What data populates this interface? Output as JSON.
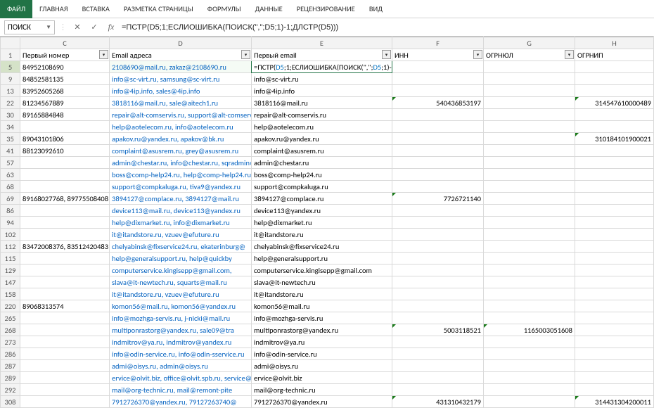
{
  "ribbon": {
    "tabs": [
      "ФАЙЛ",
      "ГЛАВНАЯ",
      "ВСТАВКА",
      "РАЗМЕТКА СТРАНИЦЫ",
      "ФОРМУЛЫ",
      "ДАННЫЕ",
      "РЕЦЕНЗИРОВАНИЕ",
      "ВИД"
    ],
    "active": 0
  },
  "formula_bar": {
    "namebox": "ПОИСК",
    "formula_plain": "=ПСТР(D5;1;ЕСЛИОШИБКА(ПОИСК(\",\";D5;1)-1;ДЛСТР(D5)))",
    "cell_formula": "=ПСТР(D5;1;ЕСЛИОШИБКА(ПОИСК(\",\";D5;1)-1;ДЛСТР(D5)))"
  },
  "columns": [
    "C",
    "D",
    "E",
    "F",
    "G",
    "H"
  ],
  "headers": {
    "C": "Первый номер",
    "D": "Email адреса",
    "E": "Первый email",
    "F": "ИНН",
    "G": "ОГРНЮЛ",
    "H": "ОГРНИП"
  },
  "rows": [
    {
      "n": "5",
      "C": "84952108690",
      "D": "2108690@mail.ru, zakaz@2108690.ru",
      "E": "=ПСТР(D5;1;ЕСЛИОШИБКА(ПОИСК(\",\";D5;1)-1;ДЛСТР(D5)))",
      "F": "",
      "G": "",
      "H": ""
    },
    {
      "n": "9",
      "C": "84852581135",
      "D": "info@sc-virt.ru, samsung@sc-virt.ru",
      "E": "info@sc-virt.ru",
      "F": "",
      "G": "",
      "H": ""
    },
    {
      "n": "13",
      "C": "83952605268",
      "D": "info@4ip.info, sales@4ip.info",
      "E": "info@4ip.info",
      "F": "",
      "G": "",
      "H": ""
    },
    {
      "n": "22",
      "C": "81234567889",
      "D": "3818116@mail.ru, sale@aitech1.ru",
      "E": "3818116@mail.ru",
      "F": "540436853197",
      "G": "",
      "H": "314547610000489"
    },
    {
      "n": "30",
      "C": "89165884848",
      "D": "repair@alt-comservis.ru, support@alt-comservis.ru",
      "E": "repair@alt-comservis.ru",
      "F": "",
      "G": "",
      "H": ""
    },
    {
      "n": "34",
      "C": "",
      "D": "help@aotelecom.ru, info@aotelecom.ru",
      "E": "help@aotelecom.ru",
      "F": "",
      "G": "",
      "H": ""
    },
    {
      "n": "35",
      "C": "89043101806",
      "D": "apakov.ru@yandex.ru, apakov@bk.ru",
      "E": "apakov.ru@yandex.ru",
      "F": "",
      "G": "",
      "H": "310184101900021"
    },
    {
      "n": "41",
      "C": "88123092610",
      "D": "complaint@asusrem.ru, grey@asusrem.ru",
      "E": "complaint@asusrem.ru",
      "F": "",
      "G": "",
      "H": ""
    },
    {
      "n": "57",
      "C": "",
      "D": "admin@chestar.ru, info@chestar.ru, sqradmin@chestar.ru",
      "E": "admin@chestar.ru",
      "F": "",
      "G": "",
      "H": ""
    },
    {
      "n": "63",
      "C": "",
      "D": "boss@comp-help24.ru, help@comp-help24.ru",
      "E": "boss@comp-help24.ru",
      "F": "",
      "G": "",
      "H": ""
    },
    {
      "n": "68",
      "C": "",
      "D": "support@compkaluga.ru, tiva9@yandex.ru",
      "E": "support@compkaluga.ru",
      "F": "",
      "G": "",
      "H": ""
    },
    {
      "n": "69",
      "C": "89168027768, 89775508408",
      "D": "3894127@complace.ru, 3894127@mail.ru",
      "E": "3894127@complace.ru",
      "F": "7726721140",
      "G": "",
      "H": ""
    },
    {
      "n": "86",
      "C": "",
      "D": "device113@mail.ru, device113@yandex.ru",
      "E": "device113@yandex.ru",
      "F": "",
      "G": "",
      "H": ""
    },
    {
      "n": "94",
      "C": "",
      "D": "help@dixmarket.ru, info@dixmarket.ru",
      "E": "help@dixmarket.ru",
      "F": "",
      "G": "",
      "H": ""
    },
    {
      "n": "102",
      "C": "",
      "D": "it@itandstore.ru, vzuev@efuture.ru",
      "E": "it@itandstore.ru",
      "F": "",
      "G": "",
      "H": ""
    },
    {
      "n": "112",
      "C": "83472008376, 83512420483",
      "D": "chelyabinsk@fixservice24.ru, ekaterinburg@",
      "E": "chelyabinsk@fixservice24.ru",
      "F": "",
      "G": "",
      "H": ""
    },
    {
      "n": "115",
      "C": "",
      "D": "help@generalsupport.ru, help@quickby",
      "E": "help@generalsupport.ru",
      "F": "",
      "G": "",
      "H": ""
    },
    {
      "n": "129",
      "C": "",
      "D": "computerservice.kingisepp@gmail.com,",
      "E": "computerservice.kingisepp@gmail.com",
      "F": "",
      "G": "",
      "H": ""
    },
    {
      "n": "147",
      "C": "",
      "D": "slava@it-newtech.ru, squarts@mail.ru",
      "E": "slava@it-newtech.ru",
      "F": "",
      "G": "",
      "H": ""
    },
    {
      "n": "158",
      "C": "",
      "D": "it@itandstore.ru, vzuev@efuture.ru",
      "E": "it@itandstore.ru",
      "F": "",
      "G": "",
      "H": ""
    },
    {
      "n": "220",
      "C": "89068313574",
      "D": "komon56@mail.ru, komon56@yandex.ru",
      "E": "komon56@mail.ru",
      "F": "",
      "G": "",
      "H": ""
    },
    {
      "n": "265",
      "C": "",
      "D": "info@mozhga-servis.ru, j-nicki@mail.ru",
      "E": "info@mozhga-servis.ru",
      "F": "",
      "G": "",
      "H": ""
    },
    {
      "n": "268",
      "C": "",
      "D": "multiponrastorg@yandex.ru, sale09@tra",
      "E": "multiponrastorg@yandex.ru",
      "F": "5003118521",
      "G": "1165003051608",
      "H": ""
    },
    {
      "n": "273",
      "C": "",
      "D": "indmitrov@ya.ru, indmitrov@yandex.ru",
      "E": "indmitrov@ya.ru",
      "F": "",
      "G": "",
      "H": ""
    },
    {
      "n": "286",
      "C": "",
      "D": "info@odin-service.ru, info@odin-sservice.ru",
      "E": "info@odin-service.ru",
      "F": "",
      "G": "",
      "H": ""
    },
    {
      "n": "287",
      "C": "",
      "D": "admi@oisys.ru, admin@oisys.ru",
      "E": "admi@oisys.ru",
      "F": "",
      "G": "",
      "H": ""
    },
    {
      "n": "289",
      "C": "",
      "D": "ervice@olvit.biz, office@olvit.spb.ru, service@olvit.biz",
      "E": "ervice@olvit.biz",
      "F": "",
      "G": "",
      "H": ""
    },
    {
      "n": "292",
      "C": "",
      "D": "mail@org-technic.ru, mail@remont-pite",
      "E": "mail@org-technic.ru",
      "F": "",
      "G": "",
      "H": ""
    },
    {
      "n": "308",
      "C": "",
      "D": "7912726370@yandex.ru, 79127263740@",
      "E": "7912726370@yandex.ru",
      "F": "431310432179",
      "G": "",
      "H": "314431304200011"
    }
  ]
}
